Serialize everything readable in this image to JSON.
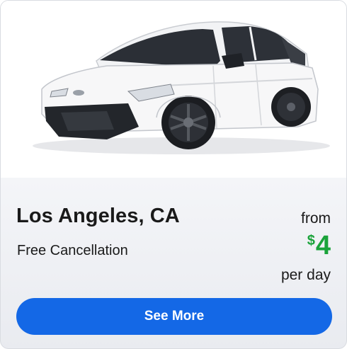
{
  "listing": {
    "location": "Los Angeles, CA",
    "cancellation": "Free Cancellation",
    "price_prefix": "from",
    "currency_symbol": "$",
    "price": "4",
    "price_suffix": "per day"
  },
  "actions": {
    "see_more_label": "See More"
  },
  "image": {
    "icon": "car-photo"
  },
  "colors": {
    "price": "#1aa33a",
    "button": "#1468e6"
  }
}
